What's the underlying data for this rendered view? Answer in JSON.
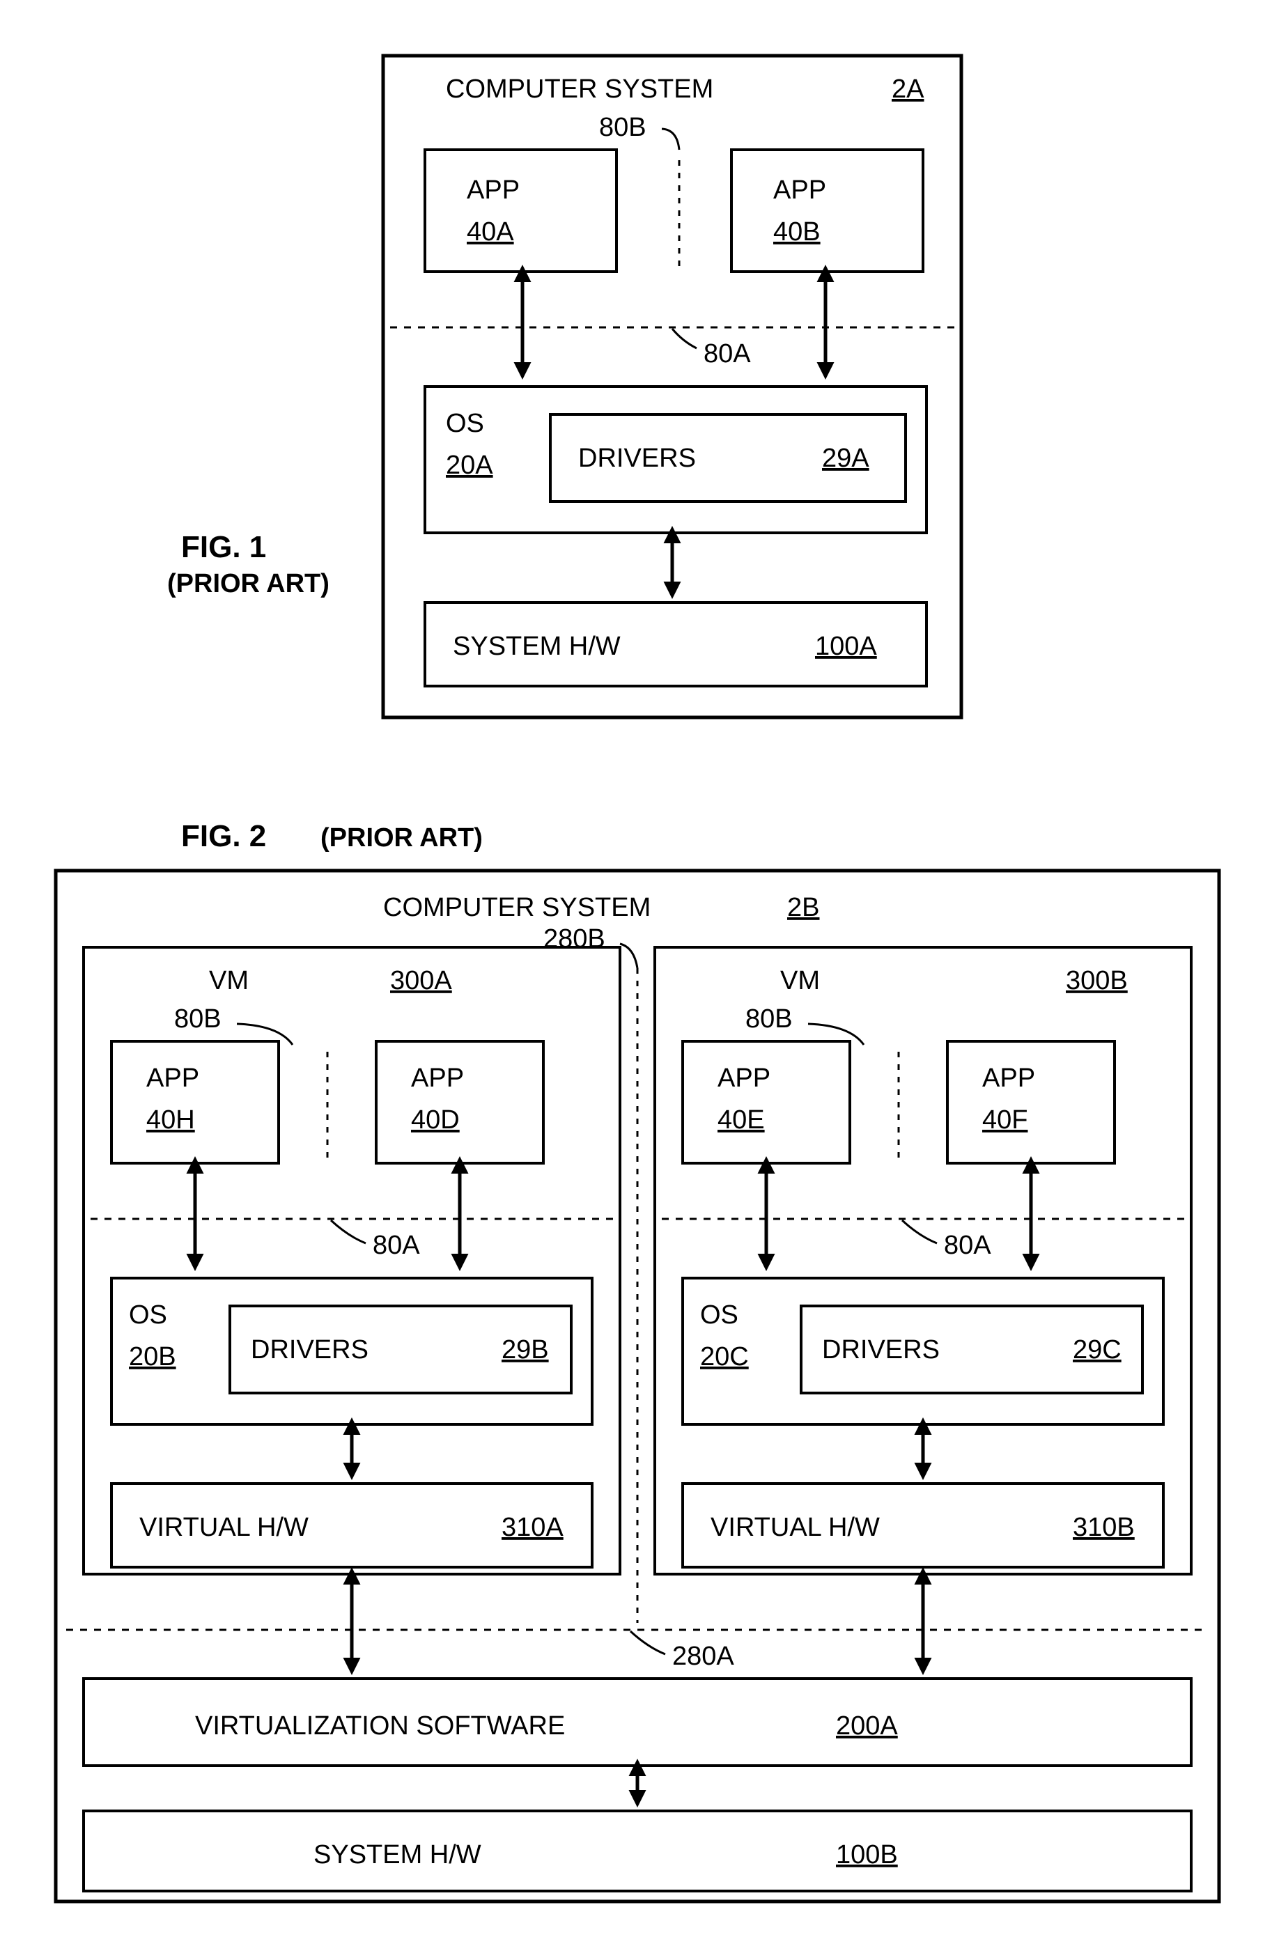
{
  "fig1": {
    "caption": "FIG. 1",
    "subcaption": "(PRIOR ART)",
    "title": "COMPUTER SYSTEM",
    "title_ref": "2A",
    "ref_80B": "80B",
    "ref_80A": "80A",
    "app1": {
      "label": "APP",
      "ref": "40A"
    },
    "app2": {
      "label": "APP",
      "ref": "40B"
    },
    "os": {
      "label": "OS",
      "ref": "20A"
    },
    "drivers": {
      "label": "DRIVERS",
      "ref": "29A"
    },
    "hw": {
      "label": "SYSTEM H/W",
      "ref": "100A"
    }
  },
  "fig2": {
    "caption": "FIG. 2",
    "subcaption": "(PRIOR ART)",
    "title": "COMPUTER SYSTEM",
    "title_ref": "2B",
    "ref_280B": "280B",
    "ref_280A": "280A",
    "vmA": {
      "title": "VM",
      "ref": "300A",
      "ref_80B": "80B",
      "ref_80A": "80A",
      "app1": {
        "label": "APP",
        "ref": "40H"
      },
      "app2": {
        "label": "APP",
        "ref": "40D"
      },
      "os": {
        "label": "OS",
        "ref": "20B"
      },
      "drivers": {
        "label": "DRIVERS",
        "ref": "29B"
      },
      "hw": {
        "label": "VIRTUAL H/W",
        "ref": "310A"
      }
    },
    "vmB": {
      "title": "VM",
      "ref": "300B",
      "ref_80B": "80B",
      "ref_80A": "80A",
      "app1": {
        "label": "APP",
        "ref": "40E"
      },
      "app2": {
        "label": "APP",
        "ref": "40F"
      },
      "os": {
        "label": "OS",
        "ref": "20C"
      },
      "drivers": {
        "label": "DRIVERS",
        "ref": "29C"
      },
      "hw": {
        "label": "VIRTUAL H/W",
        "ref": "310B"
      }
    },
    "virt": {
      "label": "VIRTUALIZATION SOFTWARE",
      "ref": "200A"
    },
    "hw": {
      "label": "SYSTEM H/W",
      "ref": "100B"
    }
  }
}
